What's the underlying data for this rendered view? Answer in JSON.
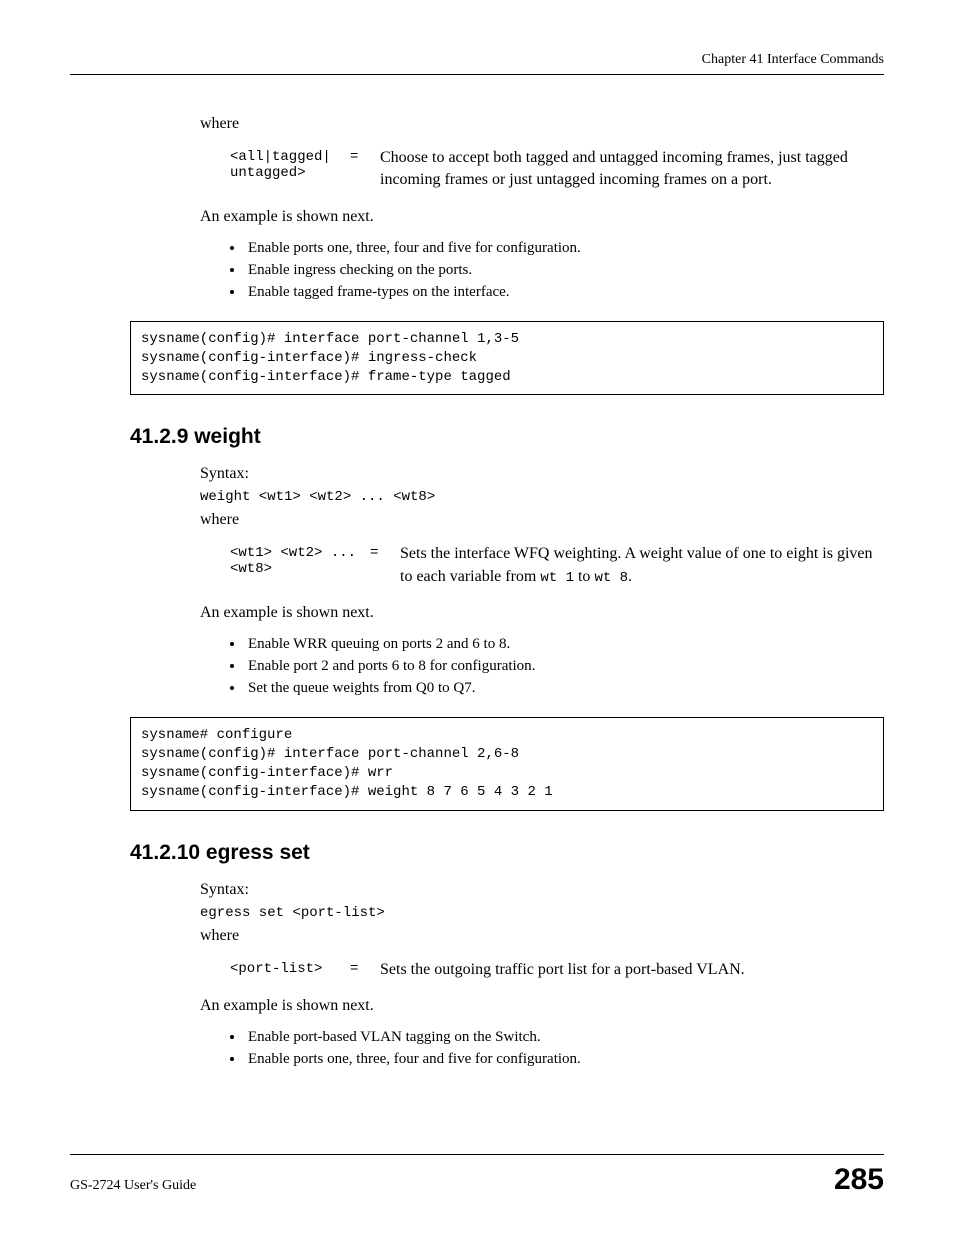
{
  "header": {
    "chapter": "Chapter 41 Interface Commands"
  },
  "section1": {
    "where": "where",
    "param_key": "<all|tagged|\nuntagged>",
    "param_eq": "=",
    "param_desc": "Choose to accept both tagged and untagged incoming frames, just tagged incoming frames or just untagged incoming frames on a port.",
    "example_intro": "An example is shown next.",
    "bullets": [
      "Enable ports one, three, four and five for configuration.",
      "Enable ingress checking on the ports.",
      "Enable tagged frame-types on the interface."
    ],
    "code": "sysname(config)# interface port-channel 1,3-5\nsysname(config-interface)# ingress-check\nsysname(config-interface)# frame-type tagged"
  },
  "section2": {
    "heading": "41.2.9  weight",
    "syntax_label": "Syntax:",
    "syntax_code": "weight <wt1> <wt2> ... <wt8>",
    "where": "where",
    "param_key": "<wt1> <wt2> ... \n<wt8>",
    "param_eq": "=",
    "param_desc_pre": "Sets the interface WFQ weighting. A weight value of one to eight is given to each variable from ",
    "param_code1": "wt 1",
    "param_mid": " to ",
    "param_code2": "wt 8",
    "param_end": ".",
    "example_intro": "An example is shown next.",
    "bullets": [
      "Enable WRR queuing on ports 2 and 6 to 8.",
      "Enable port 2 and ports 6 to 8 for configuration.",
      "Set the queue weights from Q0 to Q7."
    ],
    "code": "sysname# configure\nsysname(config)# interface port-channel 2,6-8\nsysname(config-interface)# wrr\nsysname(config-interface)# weight 8 7 6 5 4 3 2 1"
  },
  "section3": {
    "heading": "41.2.10  egress set",
    "syntax_label": "Syntax:",
    "syntax_code": "egress set <port-list>",
    "where": "where",
    "param_key": "<port-list>",
    "param_eq": "=",
    "param_desc": "Sets the outgoing traffic port list for a port-based VLAN.",
    "example_intro": "An example is shown next.",
    "bullets": [
      "Enable port-based VLAN tagging on the Switch.",
      "Enable ports one, three, four and five for configuration."
    ]
  },
  "footer": {
    "guide": "GS-2724 User's Guide",
    "page": "285"
  }
}
